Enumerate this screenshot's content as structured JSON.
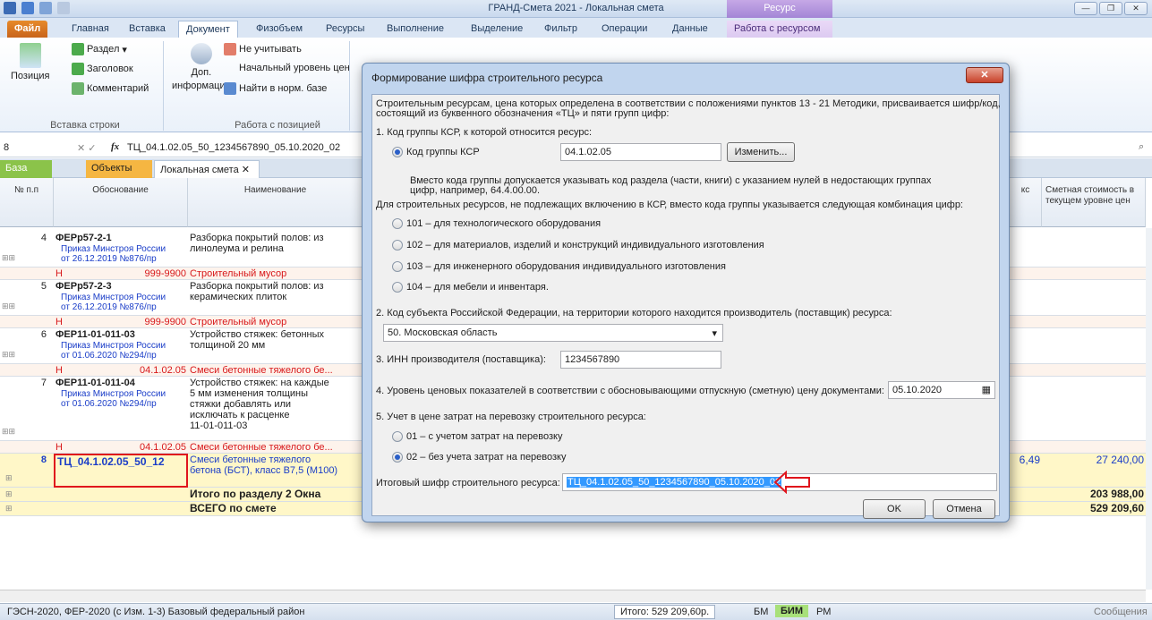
{
  "window": {
    "title": "ГРАНД-Смета 2021 - Локальная смета",
    "context_header": "Ресурс"
  },
  "tabs": [
    "Файл",
    "Главная",
    "Вставка",
    "Документ",
    "Физобъем",
    "Ресурсы",
    "Выполнение",
    "Выделение",
    "Фильтр",
    "Операции",
    "Данные",
    "Работа с ресурсом"
  ],
  "ribbon": {
    "position": "Позиция",
    "section": "Раздел",
    "heading": "Заголовок",
    "comment": "Комментарий",
    "group_insert": "Вставка строки",
    "dop_info_1": "Доп.",
    "dop_info_2": "информация",
    "ignore": "Не учитывать",
    "init_level": "Начальный уровень цен",
    "find_norm": "Найти в норм. базе",
    "group_position": "Работа с позицией"
  },
  "formula": {
    "cell_ref": "8",
    "value": "ТЦ_04.1.02.05_50_1234567890_05.10.2020_02"
  },
  "doc_tabs": [
    "База",
    "Объекты",
    "Локальная смета"
  ],
  "grid": {
    "headers": {
      "num": "№ п.п",
      "basis": "Обоснование",
      "name": "Наименование",
      "ks": "кс",
      "cost": "Сметная стоимость в текущем уровне цен"
    },
    "rows": [
      {
        "n": "4",
        "code": "ФЕРр57-2-1",
        "order1": "Приказ Минстроя России",
        "order2": "от 26.12.2019 №876/пр",
        "name": [
          "Разборка покрытий полов: из",
          "линолеума и релина"
        ]
      },
      {
        "h": "Н",
        "code": "999-9900",
        "name": "Строительный мусор"
      },
      {
        "n": "5",
        "code": "ФЕРр57-2-3",
        "order1": "Приказ Минстроя России",
        "order2": "от 26.12.2019 №876/пр",
        "name": [
          "Разборка покрытий полов: из",
          "керамических плиток"
        ]
      },
      {
        "h": "Н",
        "code": "999-9900",
        "name": "Строительный мусор"
      },
      {
        "n": "6",
        "code": "ФЕР11-01-011-03",
        "order1": "Приказ Минстроя России",
        "order2": "от 01.06.2020 №294/пр",
        "name": [
          "Устройство стяжек: бетонных",
          "толщиной 20 мм"
        ]
      },
      {
        "h": "Н",
        "code": "04.1.02.05",
        "name": "Смеси бетонные тяжелого бе..."
      },
      {
        "n": "7",
        "code": "ФЕР11-01-011-04",
        "order1": "Приказ Минстроя России",
        "order2": "от 01.06.2020 №294/пр",
        "name": [
          "Устройство стяжек: на каждые",
          "5 мм изменения толщины",
          "стяжки добавлять или",
          "исключать к расценке",
          "11-01-011-03"
        ]
      },
      {
        "h": "Н",
        "code": "04.1.02.05",
        "name": "Смеси бетонные тяжелого бе..."
      },
      {
        "n": "8",
        "code": "ТЦ_04.1.02.05_50_12",
        "name": [
          "Смеси бетонные тяжелого",
          "бетона (БСТ), класс В7,5 (М100)"
        ],
        "ks": "6,49",
        "cost": "27 240,00"
      }
    ],
    "total_section": "Итого по разделу 2 Окна",
    "total_section_value": "203 988,00",
    "total_all": "ВСЕГО по смете",
    "total_all_value": "529 209,60"
  },
  "status": {
    "left": "ГЭСН-2020, ФЕР-2020 (с Изм. 1-3)  Базовый федеральный район",
    "total": "Итого: 529 209,60р.",
    "bm": "БМ",
    "bim": "БИМ",
    "pm": "РМ",
    "messages": "Сообщения"
  },
  "dialog": {
    "title": "Формирование шифра строительного ресурса",
    "intro1": "Строительным ресурсам, цена которых определена в соответствии с положениями пунктов 13 - 21 Методики, присваивается шифр/код,",
    "intro2": "состоящий из буквенного обозначения «ТЦ» и пяти групп цифр:",
    "s1": "1. Код группы КСР, к которой относится ресурс:",
    "ksr_radio": "Код группы КСР",
    "ksr_value": "04.1.02.05",
    "change_btn": "Изменить...",
    "note1": "Вместо кода группы допускается указывать код раздела (части, книги) с указанием нулей в недостающих группах",
    "note2": "цифр, например, 64.4.00.00.",
    "not_ksr": "Для строительных ресурсов, не подлежащих включению в КСР, вместо кода группы указывается следующая комбинация цифр:",
    "opt101": "101 – для технологического оборудования",
    "opt102": "102 – для материалов, изделий и конструкций индивидуального изготовления",
    "opt103": "103 – для инженерного оборудования индивидуального изготовления",
    "opt104": "104 – для мебели и инвентаря.",
    "s2": "2. Код субъекта Российской Федерации, на территории которого находится производитель (поставщик)  ресурса:",
    "region": "50. Московская область",
    "s3": "3. ИНН производителя (поставщика):",
    "inn": "1234567890",
    "s4": "4. Уровень ценовых показателей в соответствии с обосновывающими отпускную (сметную) цену документами:",
    "date": "05.10.2020",
    "s5": "5. Учет в цене затрат на перевозку строительного ресурса:",
    "t01": "01 – с учетом затрат на перевозку",
    "t02": "02 – без учета затрат на перевозку",
    "result_label": "Итоговый шифр строительного ресурса:",
    "result": "ТЦ_04.1.02.05_50_1234567890_05.10.2020_02",
    "ok": "OK",
    "cancel": "Отмена"
  }
}
